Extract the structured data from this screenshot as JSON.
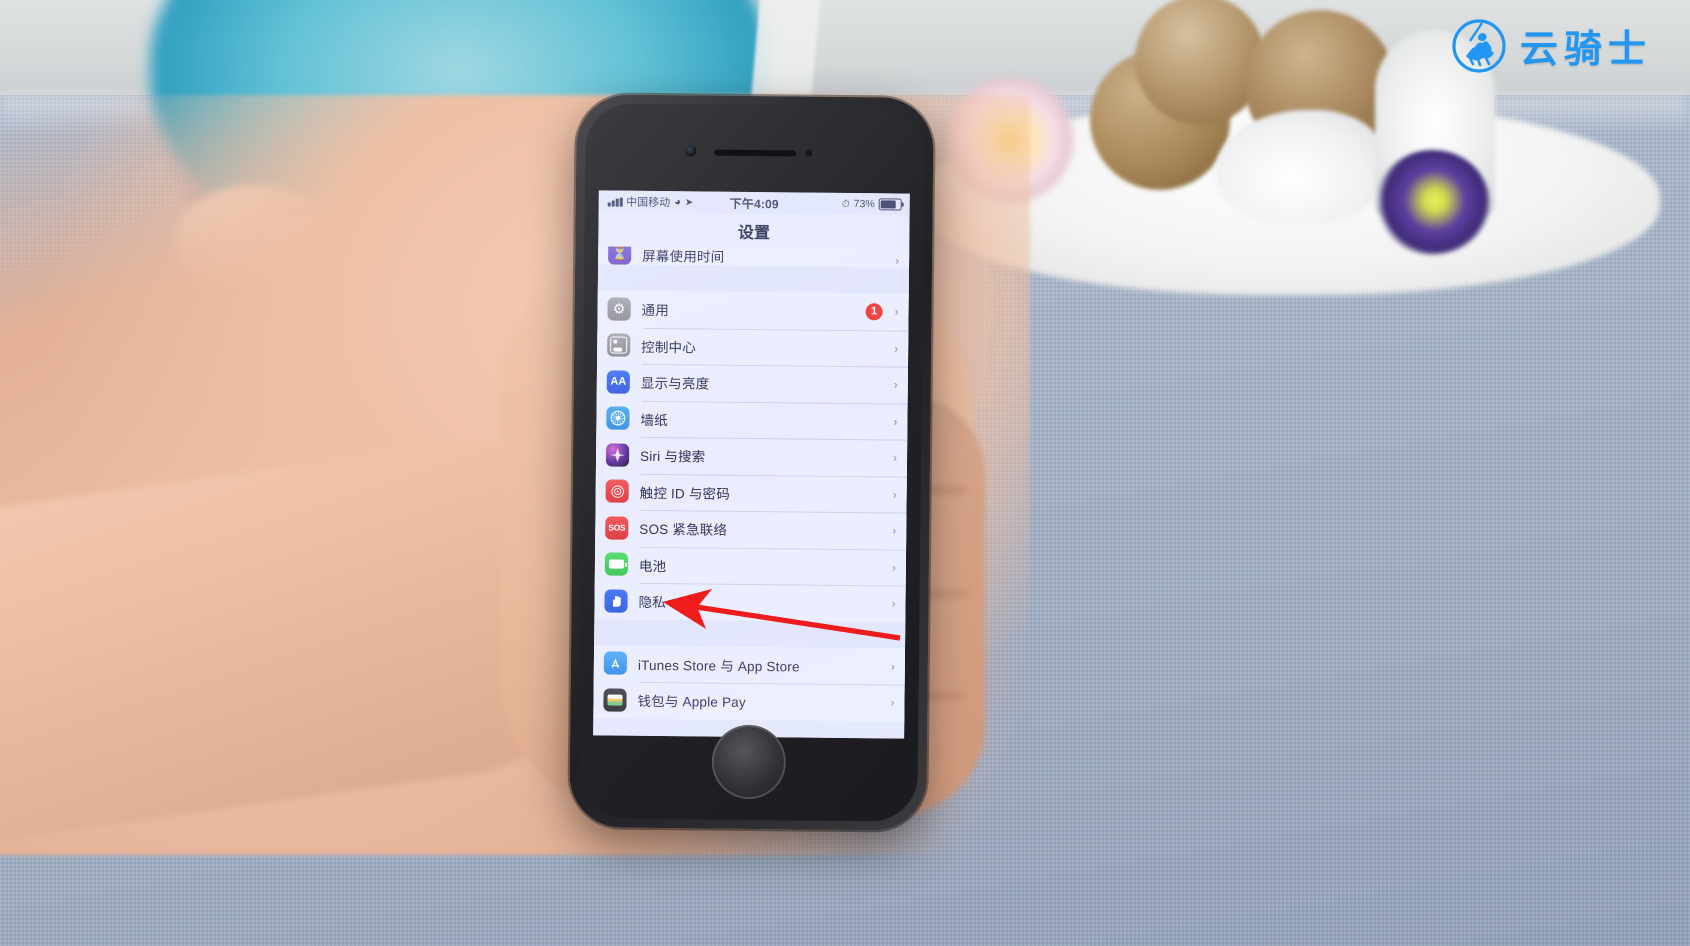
{
  "watermark": {
    "brand_text": "云骑士",
    "mark_icon": "horseman-circle-logo",
    "color": "#2196f3"
  },
  "device": {
    "model_hint": "iphone",
    "home_button_icon": "home-button"
  },
  "screen": {
    "status_bar": {
      "signal_icon": "signal-bars-icon",
      "carrier": "中国移动",
      "wifi_icon": "wifi-icon",
      "location_icon": "location-arrow-icon",
      "time": "下午4:09",
      "alarm_icon": "alarm-clock-icon",
      "battery_percent": "73%",
      "battery_icon": "battery-icon",
      "battery_level": 73
    },
    "nav_title": "设置",
    "groups": [
      {
        "name": "group-partial-top",
        "rows": [
          {
            "label": "屏幕使用时间",
            "icon": "hourglass-icon",
            "icon_class": "i-screentime",
            "glyph": "⧗",
            "accessory": "chevron-right-icon",
            "badge": null,
            "partial": true
          }
        ]
      },
      {
        "name": "group-system",
        "rows": [
          {
            "label": "通用",
            "icon": "gear-icon",
            "icon_class": "i-general",
            "glyph": "⚙",
            "accessory": "chevron-right-icon",
            "badge": "1"
          },
          {
            "label": "控制中心",
            "icon": "control-center-icon",
            "icon_class": "i-control",
            "glyph": "",
            "accessory": "chevron-right-icon",
            "badge": null
          },
          {
            "label": "显示与亮度",
            "icon": "display-brightness-icon",
            "icon_class": "i-display",
            "glyph": "AA",
            "accessory": "chevron-right-icon",
            "badge": null
          },
          {
            "label": "墙纸",
            "icon": "wallpaper-icon",
            "icon_class": "i-wallpaper",
            "glyph": "",
            "accessory": "chevron-right-icon",
            "badge": null
          },
          {
            "label": "Siri 与搜索",
            "icon": "siri-icon",
            "icon_class": "i-siri",
            "glyph": "",
            "accessory": "chevron-right-icon",
            "badge": null
          },
          {
            "label": "触控 ID 与密码",
            "icon": "touch-id-icon",
            "icon_class": "i-touchid",
            "glyph": "",
            "accessory": "chevron-right-icon",
            "badge": null
          },
          {
            "label": "SOS 紧急联络",
            "icon": "sos-icon",
            "icon_class": "i-sos",
            "glyph": "SOS",
            "accessory": "chevron-right-icon",
            "badge": null
          },
          {
            "label": "电池",
            "icon": "battery-settings-icon",
            "icon_class": "i-battery",
            "glyph": "",
            "accessory": "chevron-right-icon",
            "badge": null
          },
          {
            "label": "隐私",
            "icon": "privacy-hand-icon",
            "icon_class": "i-privacy",
            "glyph": "✋",
            "accessory": "chevron-right-icon",
            "badge": null,
            "highlighted": true
          }
        ]
      },
      {
        "name": "group-stores",
        "rows": [
          {
            "label": "iTunes Store 与 App Store",
            "icon": "app-store-icon",
            "icon_class": "i-itunes",
            "glyph": "A",
            "accessory": "chevron-right-icon",
            "badge": null
          },
          {
            "label": "钱包与 Apple Pay",
            "icon": "wallet-icon",
            "icon_class": "i-wallet",
            "glyph": "",
            "accessory": "chevron-right-icon",
            "badge": null
          }
        ]
      }
    ]
  },
  "annotation": {
    "arrow_name": "red-pointer-arrow",
    "target_label": "隐私",
    "color": "#ee1c1c"
  }
}
